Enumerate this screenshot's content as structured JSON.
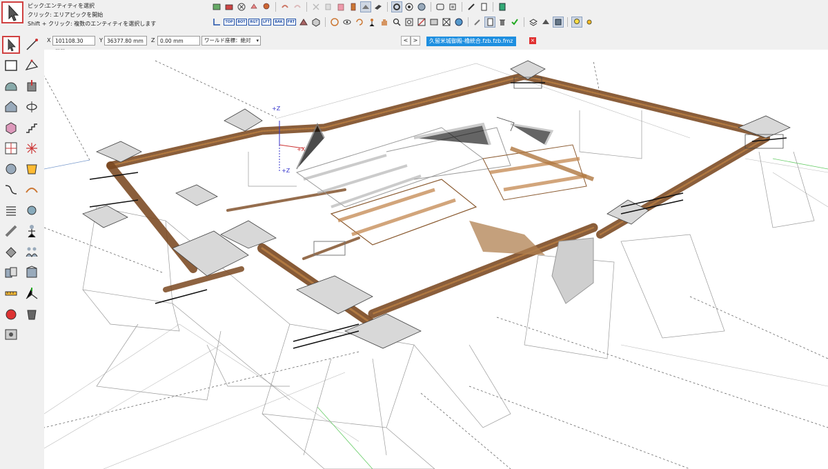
{
  "status": {
    "pick_key": "ピック:",
    "pick_value": "エンティティを選択",
    "click_hint": "クリック: エリアピックを開始",
    "shift_hint": "Shift + クリック: 複数のエンティティを選択します"
  },
  "toolbar": {
    "view_tags": [
      "TOP",
      "BOT",
      "RGT",
      "LFT",
      "BAK",
      "FRT"
    ]
  },
  "coords": {
    "x_label": "X",
    "x_value": "101108.30 mm",
    "y_label": "Y",
    "y_value": "36377.80 mm",
    "z_label": "Z",
    "z_value": "0.00 mm",
    "coord_mode": "ワールド座標：絶対"
  },
  "nav": {
    "prev": "<",
    "next": ">"
  },
  "document_tab": {
    "name": "久留米城御殿-櫓統合.fzb.fzb.fmz",
    "close": "×"
  },
  "axes": {
    "z_top": "+Z",
    "z_bottom": "+Z",
    "x": "+X"
  },
  "colors": {
    "accent": "#1e8fe0",
    "selected_border": "#d04040",
    "timber": "#7a4820",
    "timber_light": "#b07840",
    "wire": "#9a9a9a"
  }
}
